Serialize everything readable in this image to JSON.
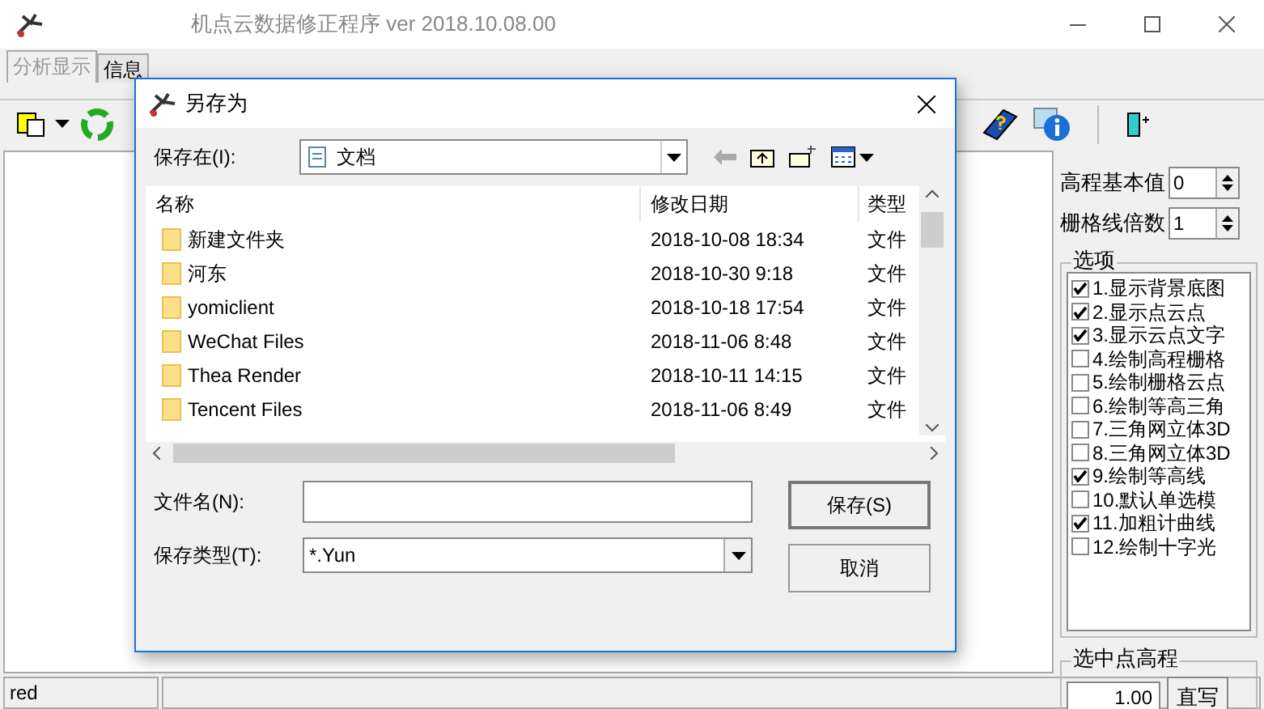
{
  "window": {
    "title": "机点云数据修正程序 ver 2018.10.08.00"
  },
  "tabs": [
    {
      "label": "分析显示",
      "selected": true
    },
    {
      "label": "信息",
      "selected": false
    }
  ],
  "right_panel": {
    "fields": [
      {
        "label": "高程基本值",
        "value": "0"
      },
      {
        "label": "栅格线倍数",
        "value": "1"
      }
    ],
    "options_group": {
      "title": "选项",
      "items": [
        {
          "label": "1.显示背景底图",
          "checked": true
        },
        {
          "label": "2.显示点云点",
          "checked": true
        },
        {
          "label": "3.显示云点文字",
          "checked": true
        },
        {
          "label": "4.绘制高程栅格",
          "checked": false
        },
        {
          "label": "5.绘制栅格云点",
          "checked": false
        },
        {
          "label": "6.绘制等高三角",
          "checked": false
        },
        {
          "label": "7.三角网立体3D",
          "checked": false
        },
        {
          "label": "8.三角网立体3D",
          "checked": false
        },
        {
          "label": "9.绘制等高线",
          "checked": true
        },
        {
          "label": "10.默认单选模",
          "checked": false
        },
        {
          "label": "11.加粗计曲线",
          "checked": true
        },
        {
          "label": "12.绘制十字光",
          "checked": false
        }
      ]
    },
    "elevation_group": {
      "title": "选中点高程",
      "value": "1.00",
      "button": "直写"
    }
  },
  "status_bar": {
    "text": "red"
  },
  "dialog": {
    "title": "另存为",
    "save_in_label": "保存在(I):",
    "save_in_value": "文档",
    "columns": [
      "名称",
      "修改日期",
      "类型"
    ],
    "rows": [
      {
        "name": "新建文件夹",
        "date": "2018-10-08 18:34",
        "type": "文件"
      },
      {
        "name": "河东",
        "date": "2018-10-30 9:18",
        "type": "文件"
      },
      {
        "name": "yomiclient",
        "date": "2018-10-18 17:54",
        "type": "文件"
      },
      {
        "name": "WeChat Files",
        "date": "2018-11-06 8:48",
        "type": "文件"
      },
      {
        "name": "Thea Render",
        "date": "2018-10-11 14:15",
        "type": "文件"
      },
      {
        "name": "Tencent Files",
        "date": "2018-11-06 8:49",
        "type": "文件"
      }
    ],
    "filename_label": "文件名(N):",
    "filetype_label": "保存类型(T):",
    "filetype_value": "*.Yun",
    "buttons": [
      "保存(S)",
      "取消"
    ]
  }
}
